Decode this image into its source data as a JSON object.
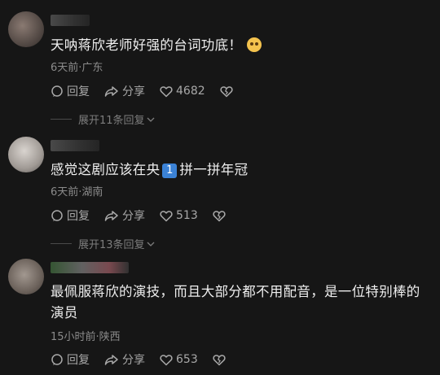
{
  "comments": [
    {
      "text": "天呐蒋欣老师好强的台词功底！",
      "emoji": "nervous-face-emoji",
      "meta": "6天前·广东",
      "reply_label": "回复",
      "share_label": "分享",
      "likes": "4682",
      "expand_label": "展开11条回复"
    },
    {
      "text_a": "感觉这剧应该在央",
      "badge": "1",
      "text_b": "拼一拼年冠",
      "meta": "6天前·湖南",
      "reply_label": "回复",
      "share_label": "分享",
      "likes": "513",
      "expand_label": "展开13条回复"
    },
    {
      "text": "最佩服蒋欣的演技，而且大部分都不用配音，是一位特别棒的演员",
      "meta": "15小时前·陕西",
      "reply_label": "回复",
      "share_label": "分享",
      "likes": "653"
    }
  ],
  "colors": {
    "background": "#161616",
    "text": "#efefef",
    "meta": "#8b8b8b",
    "badge": "#3b82d6"
  }
}
